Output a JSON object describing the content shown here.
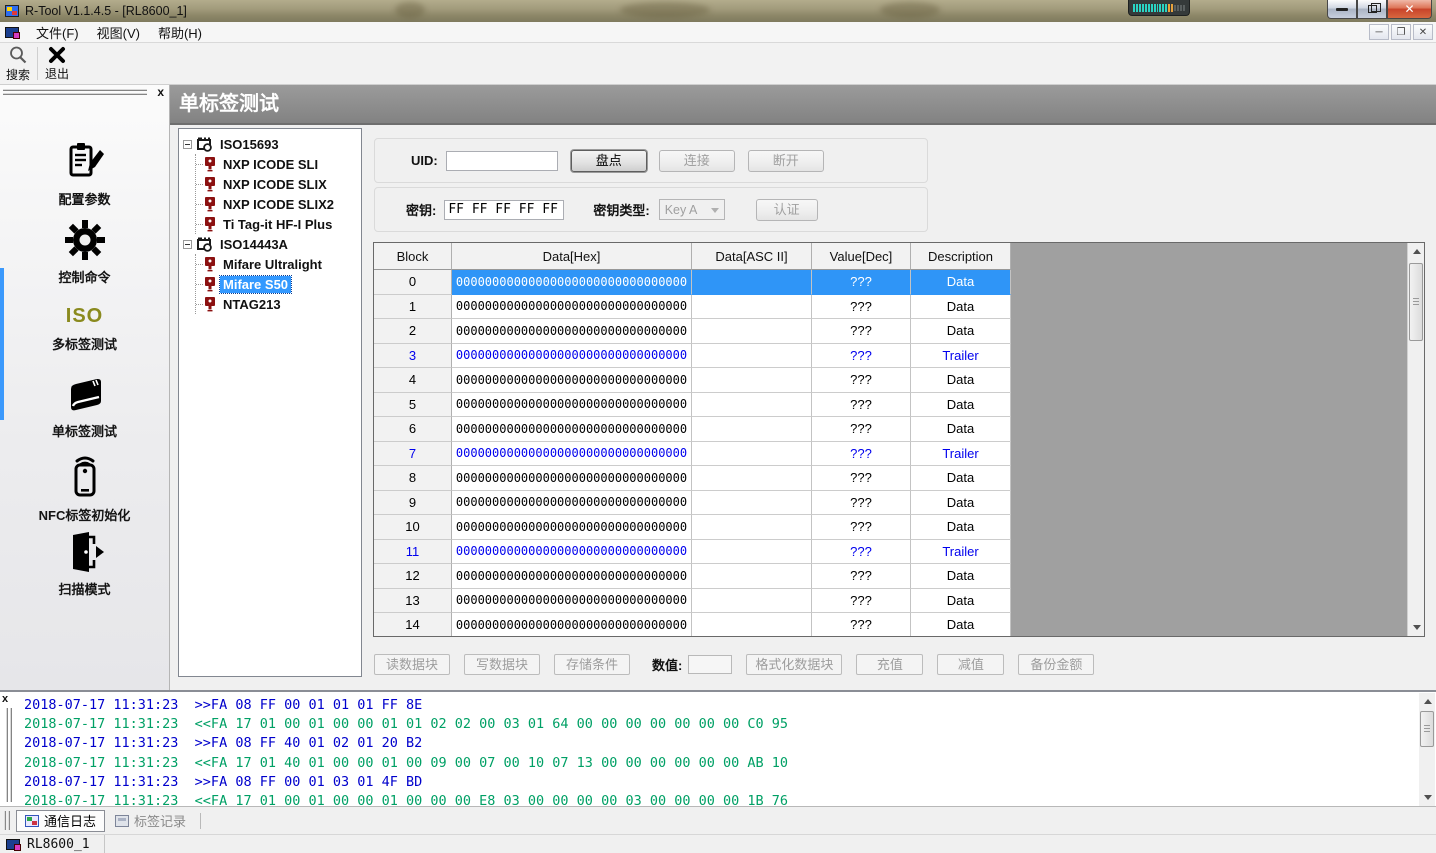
{
  "window": {
    "title": "R-Tool V1.1.4.5 - [RL8600_1]"
  },
  "menubar": {
    "items": [
      {
        "label": "文件(F)"
      },
      {
        "label": "视图(V)"
      },
      {
        "label": "帮助(H)"
      }
    ]
  },
  "toolbar": {
    "search_label": "搜索",
    "exit_label": "退出"
  },
  "sidebar": {
    "items": [
      {
        "icon": "clipboard-pencil-icon",
        "label": "配置参数"
      },
      {
        "icon": "gear-icon",
        "label": "控制命令"
      },
      {
        "icon": "iso-text",
        "iso_word": "ISO",
        "label": "多标签测试"
      },
      {
        "icon": "book-icon",
        "label": "单标签测试"
      },
      {
        "icon": "nfc-phone-icon",
        "label": "NFC标签初始化"
      },
      {
        "icon": "scan-icon",
        "label": "扫描模式"
      }
    ]
  },
  "page": {
    "title": "单标签测试"
  },
  "tree": {
    "groups": [
      {
        "label": "ISO15693",
        "children": [
          {
            "label": "NXP ICODE SLI",
            "selected": false
          },
          {
            "label": "NXP ICODE SLIX",
            "selected": false
          },
          {
            "label": "NXP ICODE SLIX2",
            "selected": false
          },
          {
            "label": "Ti Tag-it HF-I Plus",
            "selected": false
          }
        ]
      },
      {
        "label": "ISO14443A",
        "children": [
          {
            "label": "Mifare Ultralight",
            "selected": false
          },
          {
            "label": "Mifare S50",
            "selected": true
          },
          {
            "label": "NTAG213",
            "selected": false
          }
        ]
      }
    ]
  },
  "uid_panel": {
    "label": "UID:",
    "value": "",
    "inventory_btn": "盘点",
    "connect_btn": "连接",
    "disconnect_btn": "断开"
  },
  "key_panel": {
    "label": "密钥:",
    "value": "FF FF FF FF FF FF",
    "type_label": "密钥类型:",
    "type_value": "Key A",
    "auth_btn": "认证"
  },
  "block_table": {
    "headers": [
      "Block",
      "Data[Hex]",
      "Data[ASC II]",
      "Value[Dec]",
      "Description"
    ],
    "rows": [
      {
        "block": "0",
        "hex": "00000000000000000000000000000000",
        "asc": "",
        "value": "???",
        "desc": "Data",
        "selected": true
      },
      {
        "block": "1",
        "hex": "00000000000000000000000000000000",
        "asc": "",
        "value": "???",
        "desc": "Data",
        "selected": false
      },
      {
        "block": "2",
        "hex": "00000000000000000000000000000000",
        "asc": "",
        "value": "???",
        "desc": "Data",
        "selected": false
      },
      {
        "block": "3",
        "hex": "00000000000000000000000000000000",
        "asc": "",
        "value": "???",
        "desc": "Trailer",
        "selected": false
      },
      {
        "block": "4",
        "hex": "00000000000000000000000000000000",
        "asc": "",
        "value": "???",
        "desc": "Data",
        "selected": false
      },
      {
        "block": "5",
        "hex": "00000000000000000000000000000000",
        "asc": "",
        "value": "???",
        "desc": "Data",
        "selected": false
      },
      {
        "block": "6",
        "hex": "00000000000000000000000000000000",
        "asc": "",
        "value": "???",
        "desc": "Data",
        "selected": false
      },
      {
        "block": "7",
        "hex": "00000000000000000000000000000000",
        "asc": "",
        "value": "???",
        "desc": "Trailer",
        "selected": false
      },
      {
        "block": "8",
        "hex": "00000000000000000000000000000000",
        "asc": "",
        "value": "???",
        "desc": "Data",
        "selected": false
      },
      {
        "block": "9",
        "hex": "00000000000000000000000000000000",
        "asc": "",
        "value": "???",
        "desc": "Data",
        "selected": false
      },
      {
        "block": "10",
        "hex": "00000000000000000000000000000000",
        "asc": "",
        "value": "???",
        "desc": "Data",
        "selected": false
      },
      {
        "block": "11",
        "hex": "00000000000000000000000000000000",
        "asc": "",
        "value": "???",
        "desc": "Trailer",
        "selected": false
      },
      {
        "block": "12",
        "hex": "00000000000000000000000000000000",
        "asc": "",
        "value": "???",
        "desc": "Data",
        "selected": false
      },
      {
        "block": "13",
        "hex": "00000000000000000000000000000000",
        "asc": "",
        "value": "???",
        "desc": "Data",
        "selected": false
      },
      {
        "block": "14",
        "hex": "00000000000000000000000000000000",
        "asc": "",
        "value": "???",
        "desc": "Data",
        "selected": false
      }
    ]
  },
  "actions": {
    "read_btn": "读数据块",
    "write_btn": "写数据块",
    "store_btn": "存储条件",
    "value_label": "数值:",
    "value": "",
    "format_btn": "格式化数据块",
    "recharge_btn": "充值",
    "deduct_btn": "减值",
    "backup_btn": "备份金额"
  },
  "log": {
    "lines": [
      {
        "time": "2018-07-17 11:31:23",
        "dir": ">>",
        "data": "FA 08 FF 00 01 01 01 FF 8E"
      },
      {
        "time": "2018-07-17 11:31:23",
        "dir": "<<",
        "data": "FA 17 01 00 01 00 00 01 01 02 02 00 03 01 64 00 00 00 00 00 00 00 C0 95"
      },
      {
        "time": "2018-07-17 11:31:23",
        "dir": ">>",
        "data": "FA 08 FF 40 01 02 01 20 B2"
      },
      {
        "time": "2018-07-17 11:31:23",
        "dir": "<<",
        "data": "FA 17 01 40 01 00 00 01 00 09 00 07 00 10 07 13 00 00 00 00 00 00 AB 10"
      },
      {
        "time": "2018-07-17 11:31:23",
        "dir": ">>",
        "data": "FA 08 FF 00 01 03 01 4F BD"
      },
      {
        "time": "2018-07-17 11:31:23",
        "dir": "<<",
        "data": "FA 17 01 00 01 00 00 01 00 00 00 E8 03 00 00 00 00 03 00 00 00 00 1B 76"
      }
    ]
  },
  "bottom_tabs": {
    "items": [
      {
        "label": "通信日志",
        "active": true
      },
      {
        "label": "标签记录",
        "active": false
      }
    ]
  },
  "statusbar": {
    "device": "RL8600_1"
  },
  "colors": {
    "selection": "#3399ff",
    "trailer_text": "#0000ee",
    "log_tx": "#0000cc",
    "log_rx": "#00a065",
    "iso_text": "#8a8a1e"
  }
}
